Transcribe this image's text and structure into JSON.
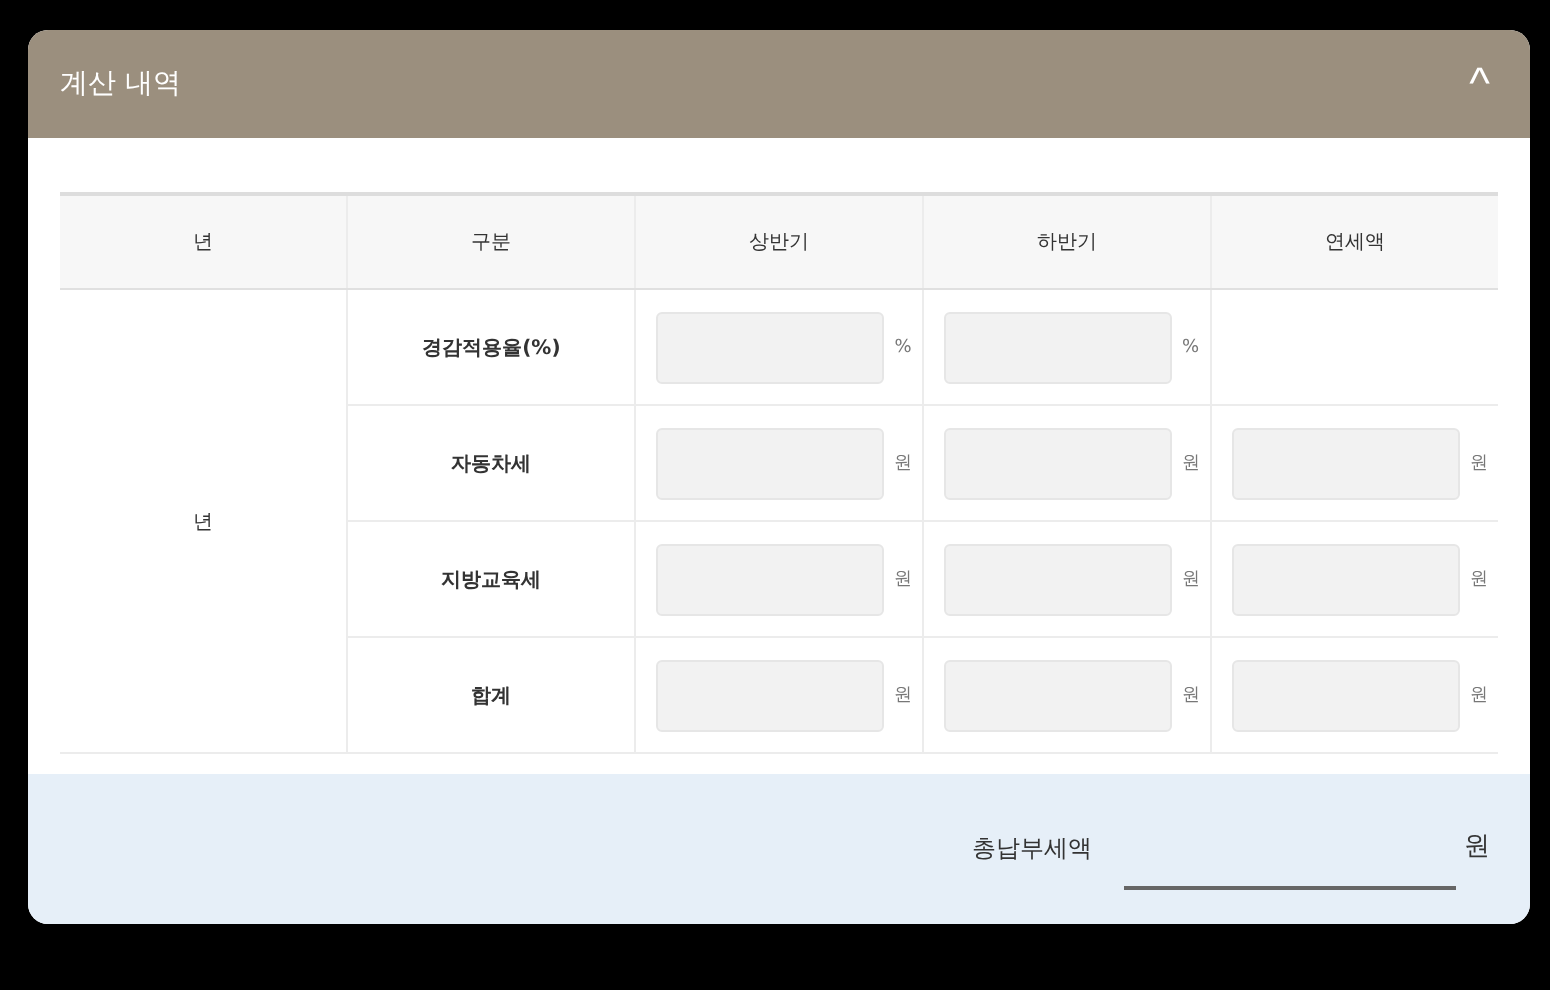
{
  "panel": {
    "title": "계산 내역",
    "toggle": "^",
    "expanded": true
  },
  "table": {
    "columns": [
      "년",
      "구분",
      "상반기",
      "하반기",
      "연세액"
    ],
    "rows": [
      {
        "cells": [
          {
            "kind": "text",
            "text": "년",
            "rowspan": 4
          },
          {
            "kind": "label",
            "text": "경감적용율(%)"
          },
          {
            "kind": "input",
            "unit": "%"
          },
          {
            "kind": "input",
            "unit": "%"
          },
          {
            "kind": "empty"
          }
        ]
      },
      {
        "cells": [
          {
            "kind": "label",
            "text": "자동차세"
          },
          {
            "kind": "input",
            "unit": "원"
          },
          {
            "kind": "input",
            "unit": "원"
          },
          {
            "kind": "input",
            "unit": "원"
          }
        ]
      },
      {
        "cells": [
          {
            "kind": "label",
            "text": "지방교육세"
          },
          {
            "kind": "input",
            "unit": "원"
          },
          {
            "kind": "input",
            "unit": "원"
          },
          {
            "kind": "input",
            "unit": "원"
          }
        ]
      },
      {
        "cells": [
          {
            "kind": "label",
            "text": "합계"
          },
          {
            "kind": "input",
            "unit": "원"
          },
          {
            "kind": "input",
            "unit": "원"
          },
          {
            "kind": "input",
            "unit": "원"
          }
        ]
      }
    ]
  },
  "total": {
    "label": "총납부세액",
    "unit": "원"
  }
}
